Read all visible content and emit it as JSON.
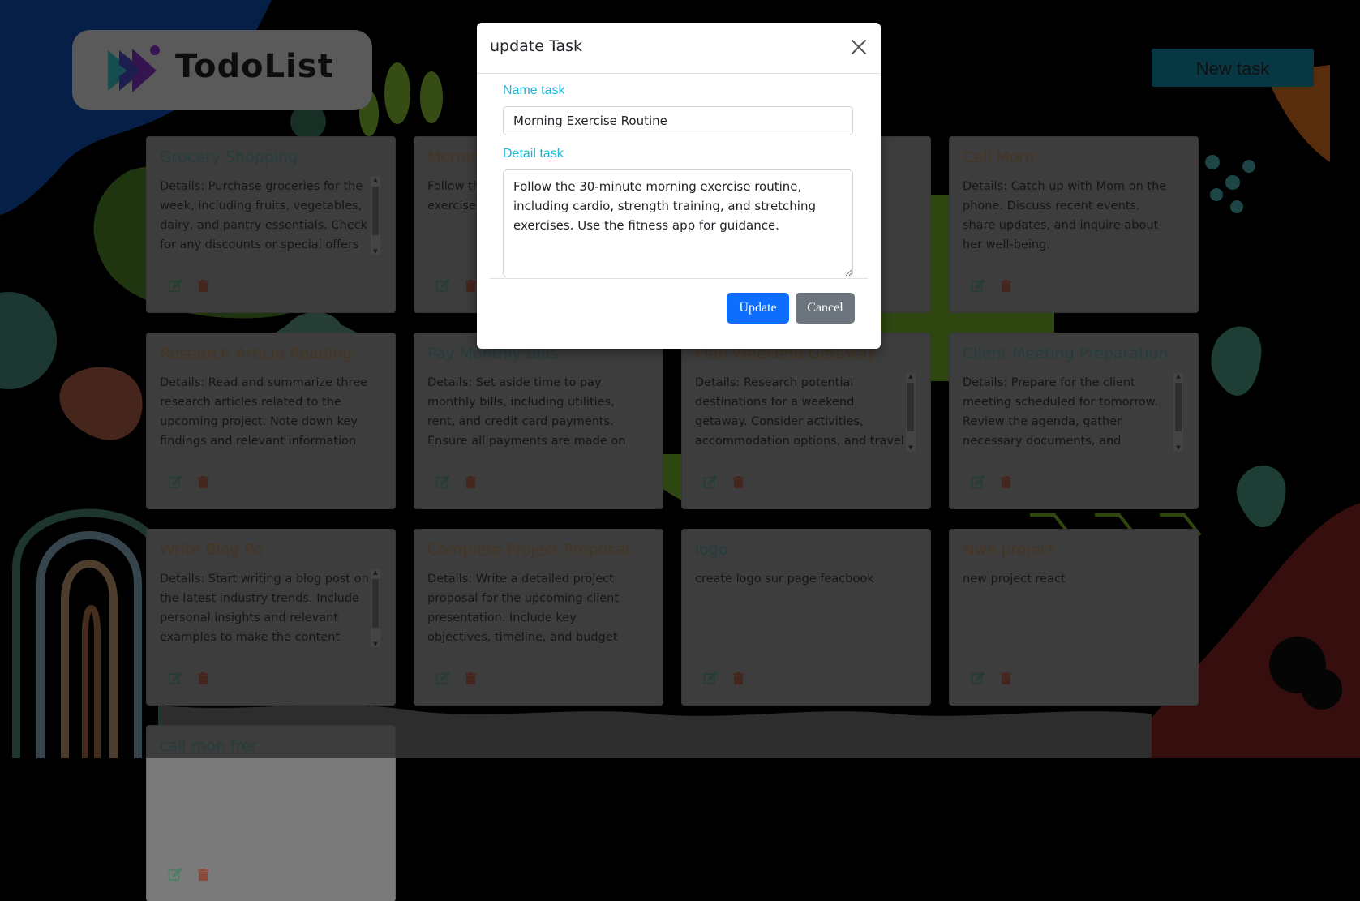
{
  "header": {
    "logo_text": "TodoList",
    "new_task_label": "New task"
  },
  "tasks": [
    {
      "title": "Grocery Shopping",
      "details": "Details: Purchase groceries for the week, including fruits, vegetables, dairy, and pantry essentials. Check for any discounts or special offers at",
      "title_color": "teal",
      "scroll": true
    },
    {
      "title": "Mornin",
      "details": "Follow th exercise strength exercises",
      "title_color": "brown",
      "scroll": false
    },
    {
      "title": "",
      "details": "he are well-",
      "title_color": "brown",
      "scroll": false
    },
    {
      "title": "Call Mom",
      "details": "Details: Catch up with Mom on the phone. Discuss recent events, share updates, and inquire about her well-being.",
      "title_color": "brown",
      "scroll": false
    },
    {
      "title": "Research Article Reading",
      "details": "Details: Read and summarize three research articles related to the upcoming project. Note down key findings and relevant information",
      "title_color": "brown",
      "scroll": false
    },
    {
      "title": "Pay Monthly Bills",
      "details": "Details: Set aside time to pay monthly bills, including utilities, rent, and credit card payments. Ensure all payments are made on time",
      "title_color": "teal",
      "scroll": false
    },
    {
      "title": "Plan Weekend Getaway",
      "details": "Details: Research potential destinations for a weekend getaway. Consider activities, accommodation options, and travel",
      "title_color": "brown",
      "scroll": true
    },
    {
      "title": "Client Meeting Preparation",
      "details": "Details: Prepare for the client meeting scheduled for tomorrow. Review the agenda, gather necessary documents, and rehearse",
      "title_color": "teal",
      "scroll": true
    },
    {
      "title": "Write Blog Po",
      "details": "Details: Start writing a blog post on the latest industry trends. Include personal insights and relevant examples to make the content",
      "title_color": "brown",
      "scroll": true
    },
    {
      "title": "Complete Project Proposal",
      "details": "Details: Write a detailed project proposal for the upcoming client presentation. Include key objectives, timeline, and budget estimate",
      "title_color": "brown",
      "scroll": false
    },
    {
      "title": "logo",
      "details": "create logo sur page feacbook",
      "title_color": "teal",
      "scroll": false
    },
    {
      "title": "Nwe project",
      "details": "new project react",
      "title_color": "brown",
      "scroll": false
    },
    {
      "title": "call mon frer",
      "details": "",
      "title_color": "teal",
      "scroll": false
    }
  ],
  "modal": {
    "title": "update Task",
    "name_label": "Name task",
    "name_value": "Morning Exercise Routine",
    "detail_label": "Detail task",
    "detail_value": "Follow the 30-minute morning exercise routine, including cardio, strength training, and stretching exercises. Use the fitness app for guidance.",
    "update_label": "Update",
    "cancel_label": "Cancel"
  },
  "colors": {
    "accent_cyan": "#1fb6d5",
    "update_blue": "#0d6efd",
    "cancel_gray": "#6c757d",
    "new_task_teal": "#0f6f87"
  }
}
